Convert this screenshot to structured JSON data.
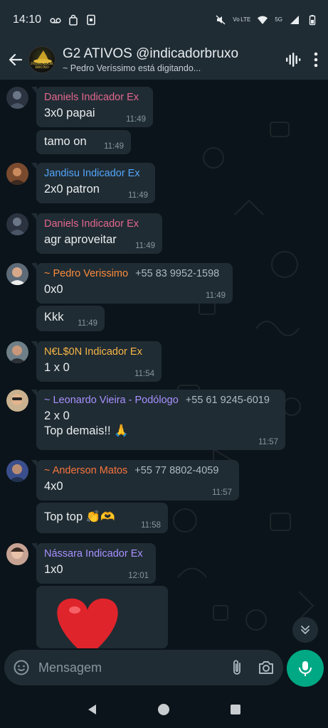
{
  "status_bar": {
    "time": "14:10",
    "volte": "Vo LTE",
    "network": "5G"
  },
  "header": {
    "group_name": "G2 ATIVOS @indicadorbruxo",
    "typing": "~ Pedro Veríssimo está digitando...",
    "avatar_text": "INDICADOR BRUXO"
  },
  "messages": [
    {
      "sender": "Daniels Indicador Ex",
      "sender_color": "#e3678f",
      "text": "3x0 papai",
      "time": "11:49"
    },
    {
      "text": "tamo on",
      "time": "11:49"
    },
    {
      "sender": "Jandisu Indicador Ex",
      "sender_color": "#53a6fd",
      "text": "2x0 patron",
      "time": "11:49"
    },
    {
      "sender": "Daniels Indicador Ex",
      "sender_color": "#e3678f",
      "text": "agr aproveitar",
      "time": "11:49"
    },
    {
      "sender": "~ Pedro Verissimo",
      "sender_color": "#fc8c3c",
      "phone": "+55 83 9952-1598",
      "text": "0x0",
      "time": "11:49"
    },
    {
      "text": "Kkk",
      "time": "11:49"
    },
    {
      "sender": "N€L$0N Indicador Ex",
      "sender_color": "#f7b548",
      "text": "1 x 0",
      "time": "11:54"
    },
    {
      "sender": "~ Leonardo Vieira - Podólogo",
      "sender_color": "#a791ff",
      "phone": "+55 61 9245-6019",
      "text": "2 x 0",
      "text2": "Top demais!! 🙏",
      "time": "11:57"
    },
    {
      "sender": "~ Anderson Matos",
      "sender_color": "#f6743e",
      "phone": "+55 77 8802-4059",
      "text": "4x0",
      "time": "11:57"
    },
    {
      "text": "Top top 👏🫶",
      "time": "11:58"
    },
    {
      "sender": "Nássara Indicador Ex",
      "sender_color": "#a791ff",
      "text": "1x0",
      "time": "12:01"
    },
    {
      "sticker": "❤️"
    }
  ],
  "input": {
    "placeholder": "Mensagem"
  },
  "colors": {
    "background": "#0b141a",
    "bubble": "#202c33",
    "bar": "#1f2c34",
    "accent": "#00a884"
  },
  "icons": [
    "back-arrow-icon",
    "voice-call-icon",
    "more-options-icon",
    "emoji-icon",
    "attach-icon",
    "camera-icon",
    "mic-icon",
    "chevron-down-icon",
    "nav-back-icon",
    "nav-home-icon",
    "nav-recents-icon"
  ]
}
